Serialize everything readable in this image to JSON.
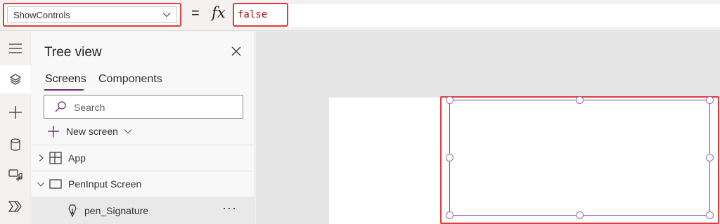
{
  "formula_bar": {
    "property": "ShowControls",
    "equals": "=",
    "fx": "fx",
    "value": "false"
  },
  "rail": {
    "icons": [
      "hamburger-icon",
      "layers-icon",
      "plus-icon",
      "database-icon",
      "media-icon",
      "power-automate-icon"
    ]
  },
  "tree": {
    "title": "Tree view",
    "tabs": {
      "screens": "Screens",
      "components": "Components"
    },
    "search_placeholder": "Search",
    "new_screen": "New screen",
    "items": [
      {
        "label": "App",
        "icon": "app-icon",
        "expanded": false
      },
      {
        "label": "PenInput Screen",
        "icon": "screen-icon",
        "expanded": true
      },
      {
        "label": "pen_Signature",
        "icon": "pen-icon",
        "selected": true,
        "more": "···"
      }
    ]
  },
  "colors": {
    "accent": "#742774",
    "highlight": "#e03c3c",
    "formula_value": "#a31515",
    "pen_border": "#6b4a9e"
  }
}
